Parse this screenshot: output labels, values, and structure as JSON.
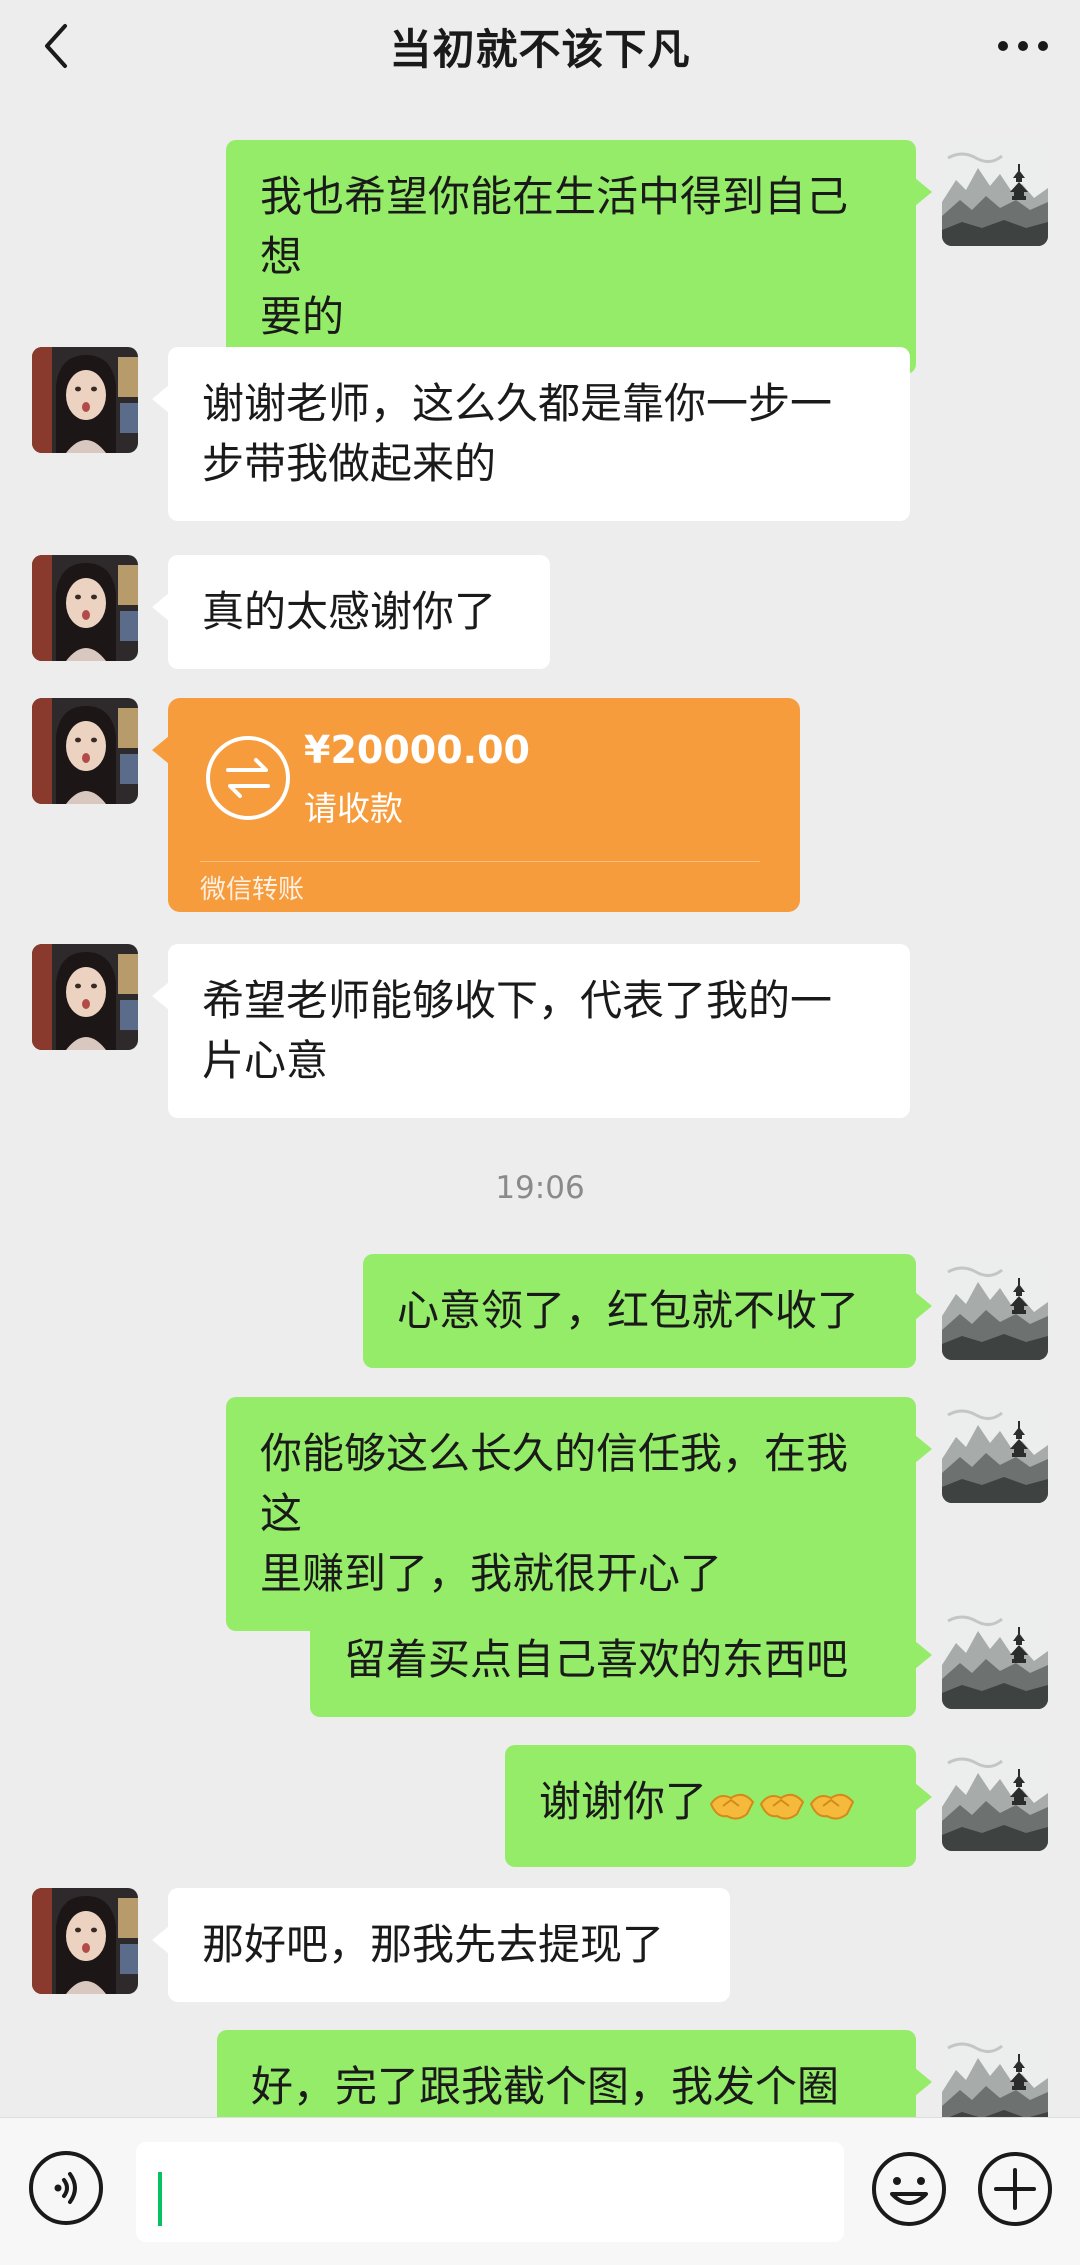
{
  "header": {
    "title": "当初就不该下凡",
    "back_icon": "chevron-left-icon",
    "more_icon": "ellipsis-icon"
  },
  "colors": {
    "background": "#ededed",
    "outgoing_bubble": "#95ec69",
    "incoming_bubble": "#ffffff",
    "transfer_card": "#f79c3d",
    "cursor": "#07c160"
  },
  "messages": [
    {
      "side": "out",
      "lines": [
        "我也希望你能在生活中得到自己想",
        "要的"
      ]
    },
    {
      "side": "in",
      "lines": [
        "谢谢老师，这么久都是靠你一步一",
        "步带我做起来的"
      ]
    },
    {
      "side": "in",
      "lines": [
        "真的太感谢你了"
      ]
    },
    {
      "side": "in",
      "type": "transfer",
      "amount": "¥20000.00",
      "status": "请收款",
      "footer": "微信转账"
    },
    {
      "side": "in",
      "lines": [
        "希望老师能够收下，代表了我的一",
        "片心意"
      ]
    },
    {
      "type": "timestamp",
      "text": "19:06"
    },
    {
      "side": "out",
      "lines": [
        "心意领了，红包就不收了"
      ]
    },
    {
      "side": "out",
      "lines": [
        "你能够这么长久的信任我，在我这",
        "里赚到了，我就很开心了"
      ]
    },
    {
      "side": "out",
      "lines": [
        "留着买点自己喜欢的东西吧"
      ]
    },
    {
      "side": "out",
      "text": "谢谢你了",
      "emojis": [
        "handshake-emoji",
        "handshake-emoji",
        "handshake-emoji"
      ]
    },
    {
      "side": "in",
      "lines": [
        "那好吧，那我先去提现了"
      ]
    },
    {
      "side": "out",
      "lines": [
        "好，完了跟我截个图，我发个圈"
      ]
    }
  ],
  "input_bar": {
    "voice_icon": "voice-icon",
    "input_value": "",
    "emoji_icon": "smiley-icon",
    "plus_icon": "plus-icon"
  }
}
